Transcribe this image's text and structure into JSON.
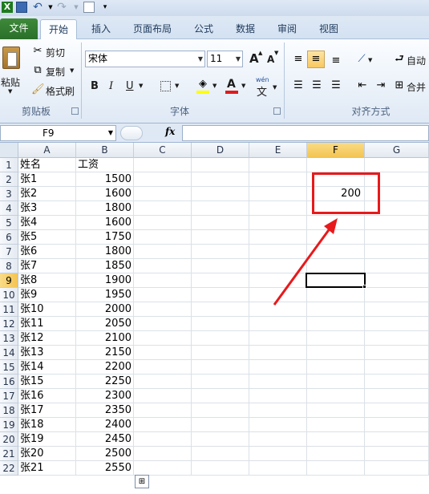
{
  "quick_access": {
    "app_icon": "excel-icon",
    "save_icon": "save-icon",
    "undo_icon": "undo-icon",
    "redo_icon": "redo-icon",
    "new_icon": "new-document-icon"
  },
  "tabs": [
    {
      "label": "文件"
    },
    {
      "label": "开始"
    },
    {
      "label": "插入"
    },
    {
      "label": "页面布局"
    },
    {
      "label": "公式"
    },
    {
      "label": "数据"
    },
    {
      "label": "审阅"
    },
    {
      "label": "视图"
    }
  ],
  "ribbon": {
    "clipboard": {
      "paste_label": "粘贴",
      "cut_label": "剪切",
      "copy_label": "复制",
      "format_painter_label": "格式刷",
      "group_label": "剪贴板"
    },
    "font": {
      "font_name": "宋体",
      "font_size": "11",
      "bold": "B",
      "italic": "I",
      "underline": "U",
      "font_color_letter": "A",
      "phonetic_label": "wén",
      "phonetic_char": "文",
      "grow_font": "A",
      "shrink_font": "A",
      "group_label": "字体"
    },
    "alignment": {
      "wrap_label": "自动",
      "merge_label": "合并",
      "group_label": "对齐方式"
    }
  },
  "formula_bar": {
    "name_box": "F9",
    "fx_label": "fx",
    "formula": ""
  },
  "sheet": {
    "columns": [
      "A",
      "B",
      "C",
      "D",
      "E",
      "F",
      "G"
    ],
    "active_column": "F",
    "active_row": "9",
    "header_row": {
      "a": "姓名",
      "b": "工资"
    },
    "rows": [
      {
        "num": "1"
      },
      {
        "num": "2",
        "a": "张1",
        "b": "1500"
      },
      {
        "num": "3",
        "a": "张2",
        "b": "1600",
        "f": "200"
      },
      {
        "num": "4",
        "a": "张3",
        "b": "1800"
      },
      {
        "num": "5",
        "a": "张4",
        "b": "1600"
      },
      {
        "num": "6",
        "a": "张5",
        "b": "1750"
      },
      {
        "num": "7",
        "a": "张6",
        "b": "1800"
      },
      {
        "num": "8",
        "a": "张7",
        "b": "1850"
      },
      {
        "num": "9",
        "a": "张8",
        "b": "1900"
      },
      {
        "num": "10",
        "a": "张9",
        "b": "1950"
      },
      {
        "num": "11",
        "a": "张10",
        "b": "2000"
      },
      {
        "num": "12",
        "a": "张11",
        "b": "2050"
      },
      {
        "num": "13",
        "a": "张12",
        "b": "2100"
      },
      {
        "num": "14",
        "a": "张13",
        "b": "2150"
      },
      {
        "num": "15",
        "a": "张14",
        "b": "2200"
      },
      {
        "num": "16",
        "a": "张15",
        "b": "2250"
      },
      {
        "num": "17",
        "a": "张16",
        "b": "2300"
      },
      {
        "num": "18",
        "a": "张17",
        "b": "2350"
      },
      {
        "num": "19",
        "a": "张18",
        "b": "2400"
      },
      {
        "num": "20",
        "a": "张19",
        "b": "2450"
      },
      {
        "num": "21",
        "a": "张20",
        "b": "2500"
      },
      {
        "num": "22",
        "a": "张21",
        "b": "2550"
      }
    ]
  },
  "annotation": {
    "color": "#e8191b"
  },
  "colors": {
    "file_tab": "#2f7b2f",
    "accent_highlight": "#f6c860"
  }
}
